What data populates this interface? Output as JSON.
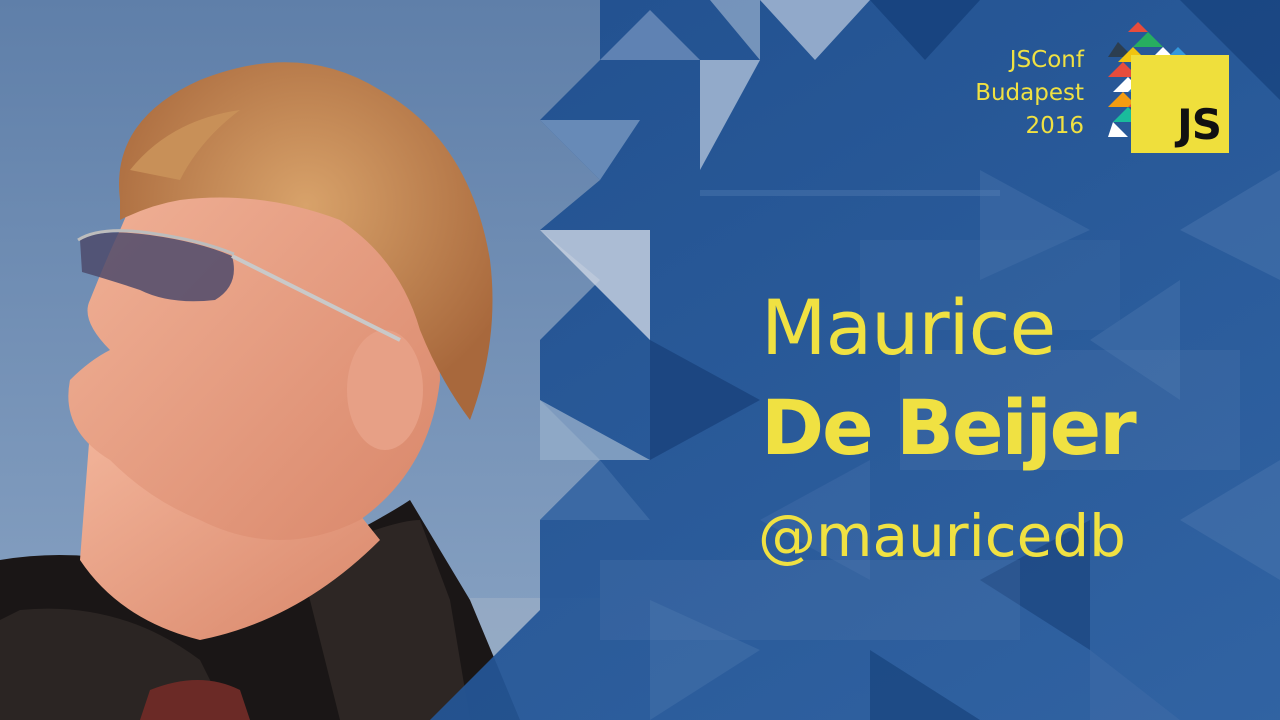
{
  "event": {
    "line1": "JSConf",
    "line2": "Budapest",
    "line3": "2016",
    "logo_text": "JS"
  },
  "speaker": {
    "first_name": "Maurice",
    "last_name": "De Beijer",
    "handle": "@mauricedb"
  },
  "colors": {
    "accent_yellow": "#f0e142",
    "panel_blue": "#1f4f8f",
    "sky": "#6f8fb6"
  }
}
